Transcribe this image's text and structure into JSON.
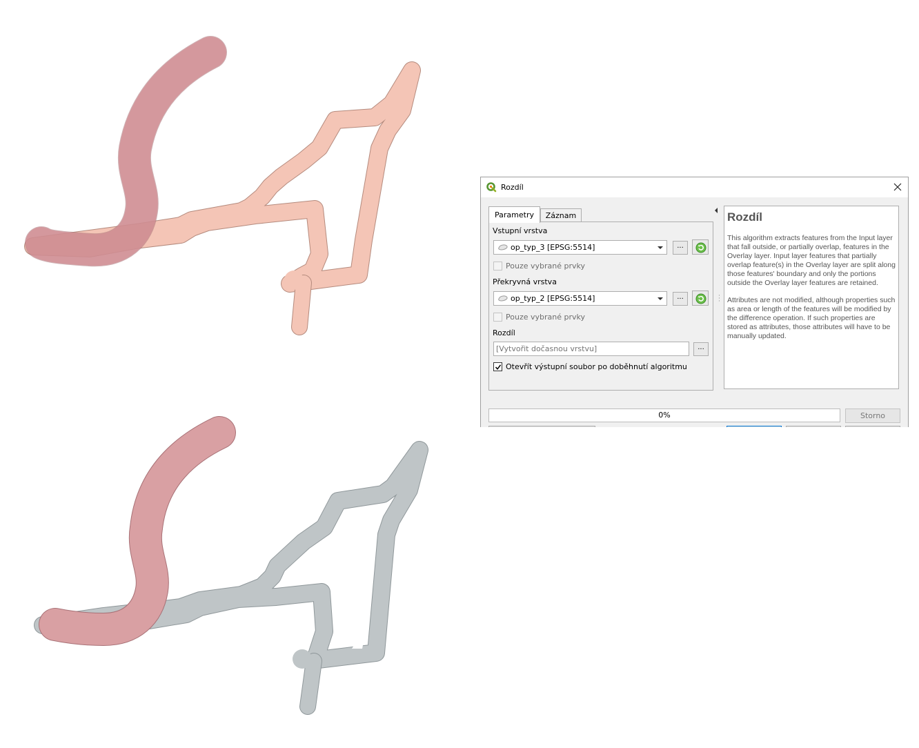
{
  "map": {
    "top_layers": {
      "overlay_color": "#d59196",
      "input_color": "#f4bfae"
    },
    "bottom_layers": {
      "overlay_color": "#d59196",
      "result_color": "#bfc5c7"
    }
  },
  "dialog": {
    "title": "Rozdíl",
    "tabs": [
      {
        "label": "Parametry",
        "active": true
      },
      {
        "label": "Záznam",
        "active": false
      }
    ],
    "input_layer": {
      "label": "Vstupní vrstva",
      "value": "op_typ_3 [EPSG:5514]",
      "selected_only_label": "Pouze vybrané prvky"
    },
    "overlay_layer": {
      "label": "Překryvná vrstva",
      "value": "op_typ_2 [EPSG:5514]",
      "selected_only_label": "Pouze vybrané prvky"
    },
    "output": {
      "label": "Rozdíl",
      "placeholder": "[Vytvořit dočasnou vrstvu]",
      "open_after_label": "Otevřít výstupní soubor po doběhnutí algoritmu",
      "open_after_checked": true
    },
    "dots_label": "...",
    "help": {
      "title": "Rozdíl",
      "paragraph1": "This algorithm extracts features from the Input layer that fall outside, or partially overlap, features in the Overlay layer. Input layer features that partially overlap feature(s) in the Overlay layer are split along those features' boundary and only the portions outside the Overlay layer features are retained.",
      "paragraph2": "Attributes are not modified, although properties such as area or length of the features will be modified by the difference operation. If such properties are stored as attributes, those attributes will have to be manually updated."
    },
    "progress": {
      "text": "0%",
      "value": 0
    },
    "cancel_label": "Storno"
  }
}
